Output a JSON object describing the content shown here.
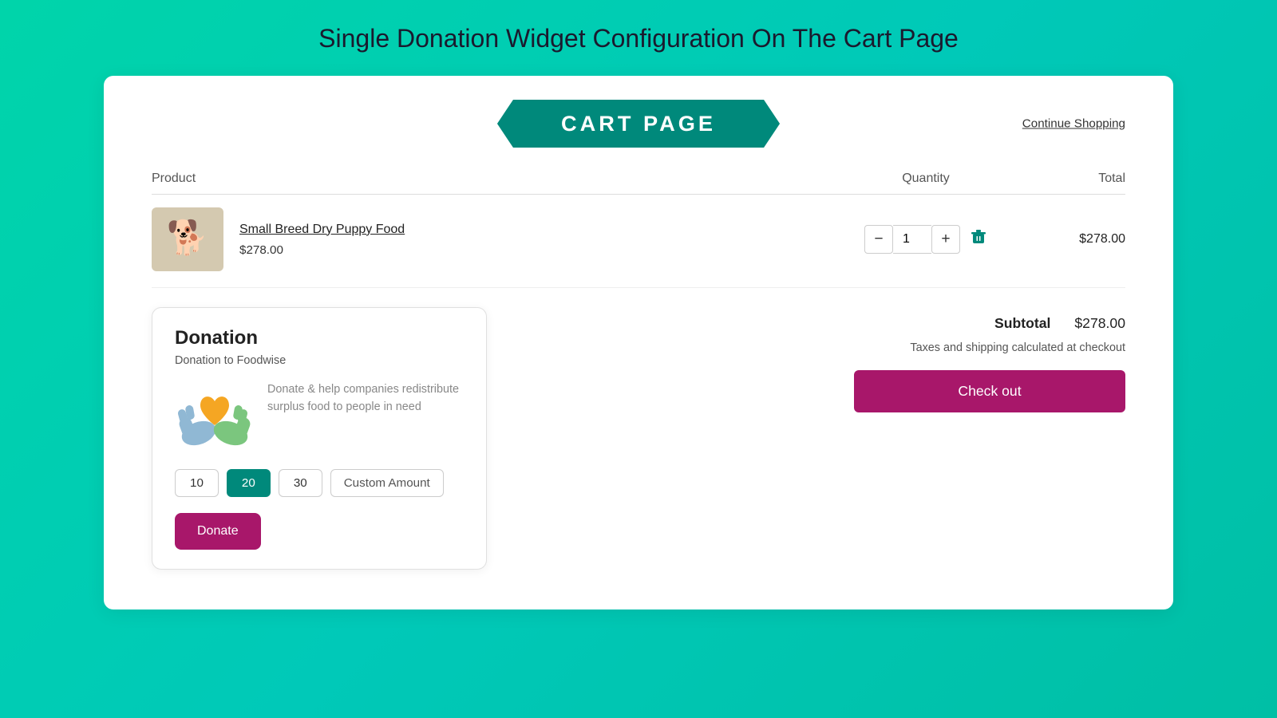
{
  "page": {
    "title": "Single Donation Widget Configuration On The Cart Page"
  },
  "header": {
    "banner_text": "CART PAGE",
    "continue_shopping": "Continue Shopping"
  },
  "table": {
    "col_product": "Product",
    "col_quantity": "Quantity",
    "col_total": "Total"
  },
  "product": {
    "name": "Small Breed Dry Puppy Food",
    "price": "$278.00",
    "quantity": 1,
    "total": "$278.00",
    "image_emoji": "🐕"
  },
  "donation": {
    "title": "Donation",
    "subtitle": "Donation to Foodwise",
    "description": "Donate & help companies redistribute surplus food to people in need",
    "amounts": [
      "10",
      "20",
      "30"
    ],
    "active_amount": "20",
    "custom_amount_label": "Custom Amount",
    "donate_button": "Donate"
  },
  "summary": {
    "subtotal_label": "Subtotal",
    "subtotal_value": "$278.00",
    "tax_note": "Taxes and shipping calculated at checkout",
    "checkout_button": "Check out"
  }
}
